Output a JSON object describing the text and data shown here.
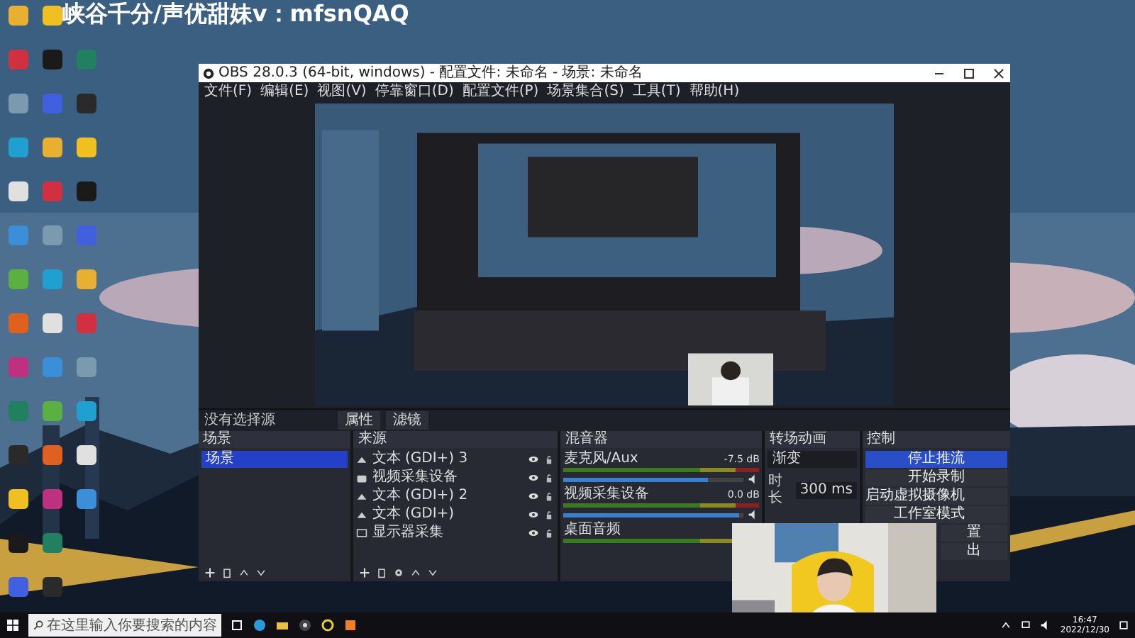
{
  "overlay_caption": "峡谷千分/声优甜妹v：mfsnQAQ",
  "obs": {
    "title": "OBS 28.0.3 (64-bit, windows) - 配置文件: 未命名 - 场景: 未命名",
    "menu": [
      "文件(F)",
      "编辑(E)",
      "视图(V)",
      "停靠窗口(D)",
      "配置文件(P)",
      "场景集合(S)",
      "工具(T)",
      "帮助(H)"
    ],
    "toolbar": {
      "status": "没有选择源",
      "buttons": [
        "属性",
        "滤镜"
      ]
    },
    "scenes": {
      "title": "场景",
      "items": [
        {
          "name": "场景",
          "selected": true
        }
      ]
    },
    "sources": {
      "title": "来源",
      "items": [
        {
          "name": "文本 (GDI+) 3",
          "kind": "text"
        },
        {
          "name": "视频采集设备",
          "kind": "camera"
        },
        {
          "name": "文本 (GDI+) 2",
          "kind": "text"
        },
        {
          "name": "文本 (GDI+)",
          "kind": "text"
        },
        {
          "name": "显示器采集",
          "kind": "display"
        }
      ]
    },
    "mixer": {
      "title": "混音器",
      "channels": [
        {
          "name": "麦克风/Aux",
          "reading": "-7.5 dB",
          "level": 0.8
        },
        {
          "name": "视频采集设备",
          "reading": "0.0 dB",
          "level": 0.97
        },
        {
          "name": "桌面音频"
        }
      ]
    },
    "transitions": {
      "title": "转场动画",
      "type": "渐变",
      "duration_label": "时长",
      "duration": "300 ms"
    },
    "controls": {
      "title": "控制",
      "buttons": [
        {
          "label": "停止推流",
          "active": true
        },
        {
          "label": "开始录制",
          "active": false
        },
        {
          "label": "启动虚拟摄像机",
          "active": false
        },
        {
          "label": "工作室模式",
          "active": false
        },
        {
          "label": "置",
          "active": false
        },
        {
          "label": "出",
          "active": false
        }
      ]
    }
  },
  "taskbar": {
    "search_placeholder": "在这里输入你要搜索的内容",
    "time": "16:47",
    "date": "2022/12/30"
  }
}
